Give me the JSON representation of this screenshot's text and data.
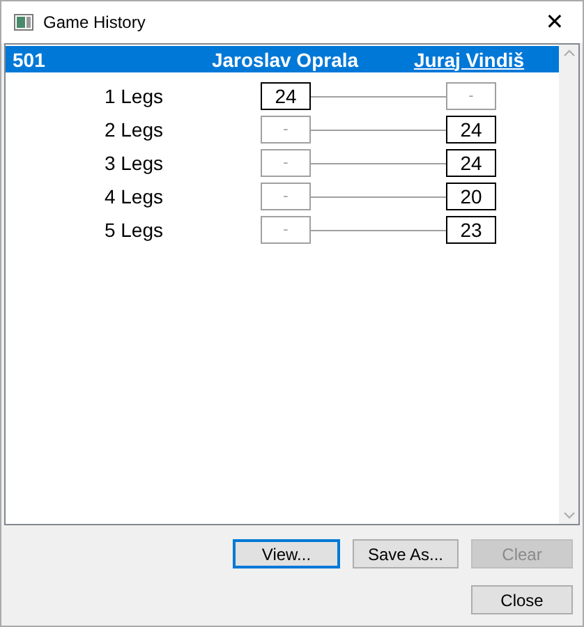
{
  "window": {
    "title": "Game History",
    "close": "✕"
  },
  "header": {
    "game": "501",
    "players": [
      {
        "name": "Jaroslav Oprala",
        "selected": false
      },
      {
        "name": "Juraj Vindiš",
        "selected": true
      }
    ]
  },
  "legs": [
    {
      "label": "1 Legs",
      "scores": [
        {
          "text": "24",
          "won": true
        },
        {
          "text": "-",
          "won": false
        }
      ]
    },
    {
      "label": "2 Legs",
      "scores": [
        {
          "text": "-",
          "won": false
        },
        {
          "text": "24",
          "won": true
        }
      ]
    },
    {
      "label": "3 Legs",
      "scores": [
        {
          "text": "-",
          "won": false
        },
        {
          "text": "24",
          "won": true
        }
      ]
    },
    {
      "label": "4 Legs",
      "scores": [
        {
          "text": "-",
          "won": false
        },
        {
          "text": "20",
          "won": true
        }
      ]
    },
    {
      "label": "5 Legs",
      "scores": [
        {
          "text": "-",
          "won": false
        },
        {
          "text": "23",
          "won": true
        }
      ]
    }
  ],
  "buttons": [
    {
      "label": "View...",
      "focused": true,
      "disabled": false
    },
    {
      "label": "Save As...",
      "focused": false,
      "disabled": false
    },
    {
      "label": "Clear",
      "focused": false,
      "disabled": true
    }
  ],
  "close_button": {
    "label": "Close",
    "focused": false,
    "disabled": false
  }
}
